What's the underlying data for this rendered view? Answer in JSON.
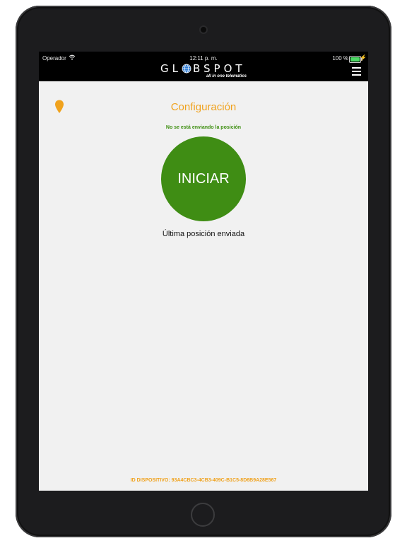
{
  "status_bar": {
    "carrier": "Operador",
    "time": "12:11 p. m.",
    "battery_percent": "100 %",
    "battery_level": 1.0,
    "icons": [
      "wifi-icon",
      "battery-icon",
      "charging-icon"
    ]
  },
  "header": {
    "brand_before": "GL",
    "brand_after": "BSPOT",
    "tagline": "all in one telematics",
    "menu_icon": "hamburger-menu-icon",
    "logo_icon": "globe-icon"
  },
  "main": {
    "location_icon": "location-pin-icon",
    "title": "Configuración",
    "status_message": "No se está enviando la posición",
    "start_button_label": "INICIAR",
    "last_position_label": "Última posición enviada",
    "device_id": "ID DISPOSITIVO: 93A4CBC3-4CB3-409C-B1C5-8D6B9A28E567"
  },
  "colors": {
    "accent_orange": "#f0a21d",
    "status_green": "#3e8f11",
    "button_green": "#3f8d14",
    "header_bg": "#000000",
    "screen_bg": "#f1f1f1",
    "device_bezel": "#1c1c1e"
  }
}
